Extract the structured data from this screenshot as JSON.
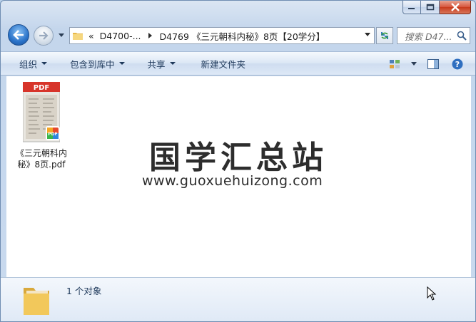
{
  "nav": {
    "breadcrumb_overflow": "«",
    "breadcrumb": [
      "D4700-...",
      "D4769 《三元朝科内秘》8页【20学分】"
    ],
    "search_placeholder": "搜索 D47..."
  },
  "toolbar": {
    "items": [
      "组织",
      "包含到库中",
      "共享",
      "新建文件夹"
    ]
  },
  "files": [
    {
      "name": "《三元朝科内秘》8页.pdf",
      "icon_label": "PDF",
      "type": "pdf"
    }
  ],
  "watermark": {
    "cn": "国学汇总站",
    "url": "www.guoxuehuizong.com"
  },
  "status": {
    "count": "1 个对象"
  },
  "colors": {
    "toolbar_text": "#1e395b",
    "pdf_red": "#d7342a",
    "folder_yellow": "#f2c85b"
  }
}
